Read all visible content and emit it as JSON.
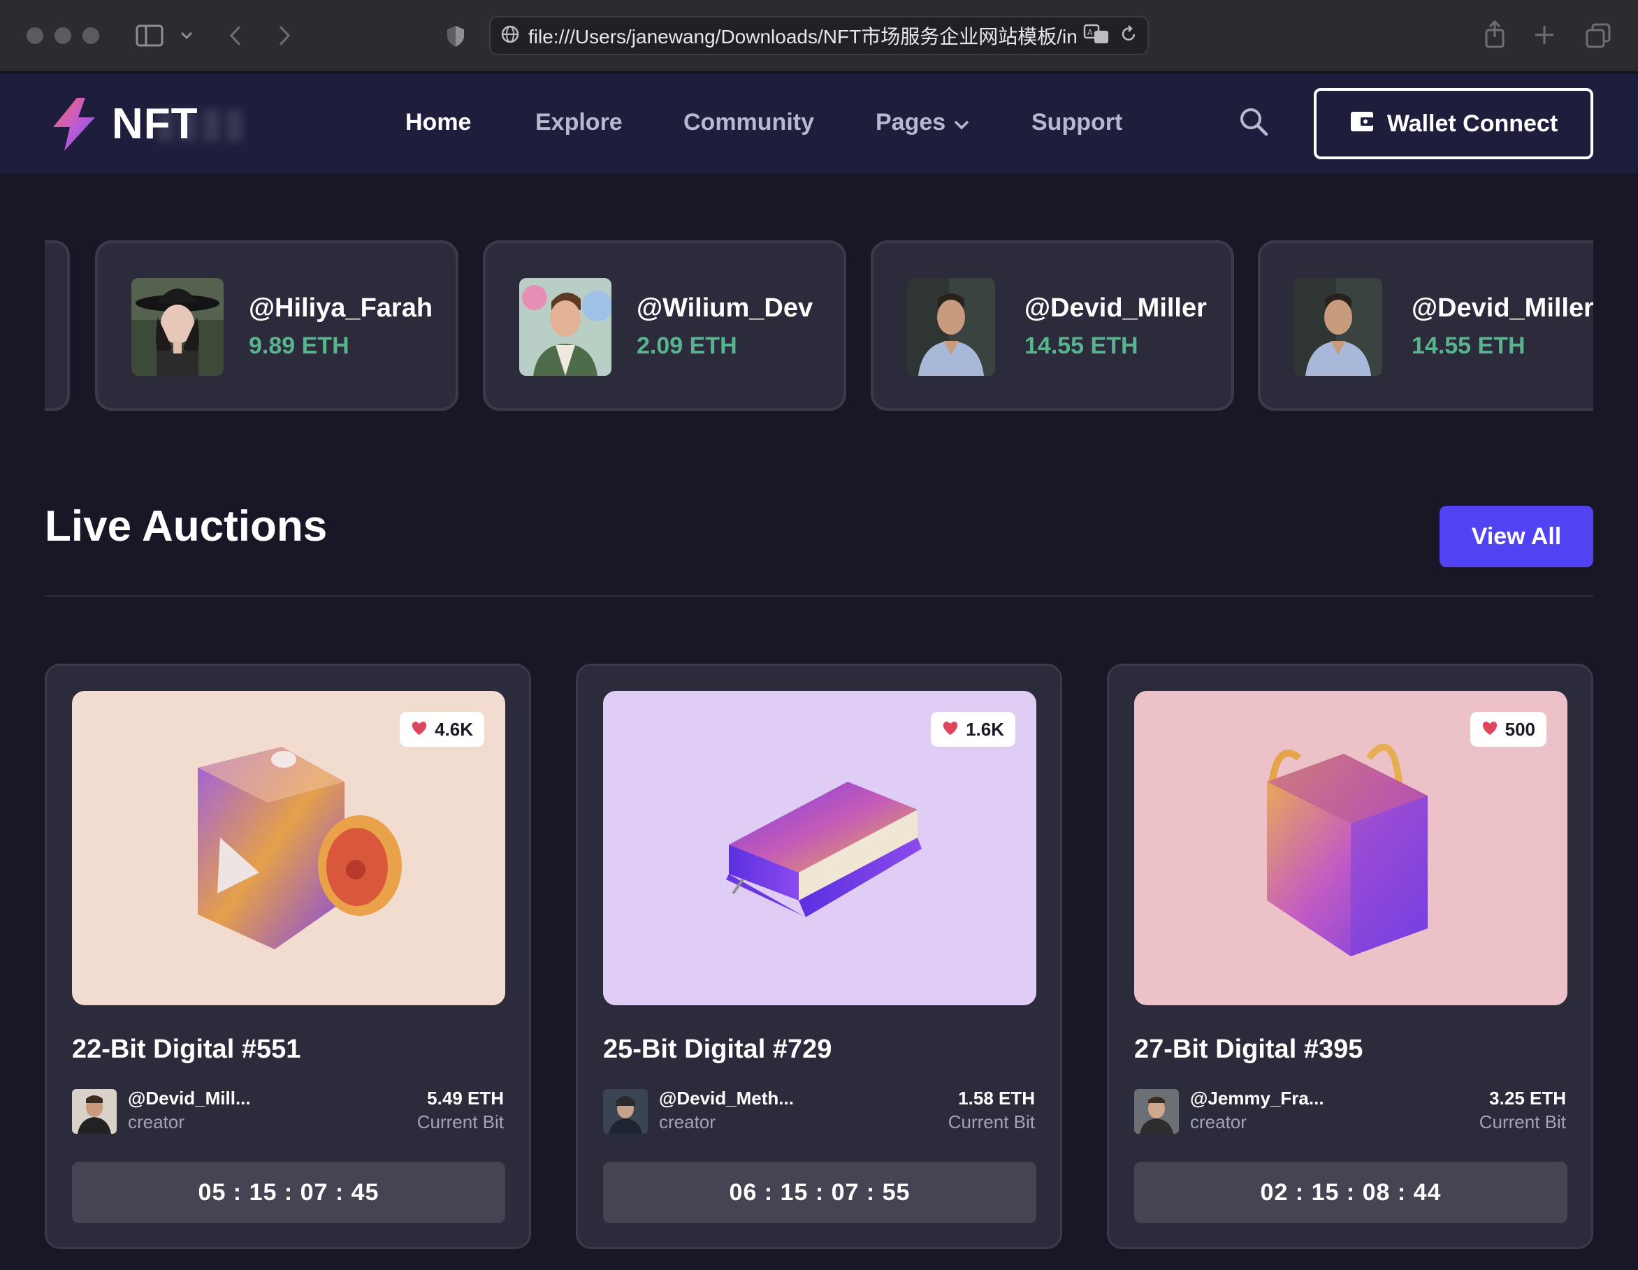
{
  "browser": {
    "url": "file:///Users/janewang/Downloads/NFT市场服务企业网站模板/inde:"
  },
  "header": {
    "logo_text": "NFT",
    "nav": [
      {
        "label": "Home",
        "active": true
      },
      {
        "label": "Explore"
      },
      {
        "label": "Community"
      },
      {
        "label": "Pages"
      },
      {
        "label": "Support"
      }
    ],
    "wallet_label": "Wallet Connect"
  },
  "sellers": [
    {
      "name": "@Hiliya_Farah",
      "eth": "9.89 ETH"
    },
    {
      "name": "@Wilium_Dev",
      "eth": "2.09 ETH"
    },
    {
      "name": "@Devid_Miller",
      "eth": "14.55 ETH"
    },
    {
      "name": "@Devid_Miller",
      "eth": "14.55 ETH"
    }
  ],
  "auctions": {
    "title": "Live Auctions",
    "view_all": "View All",
    "cards": [
      {
        "likes": "4.6K",
        "title": "22-Bit Digital #551",
        "creator": "@Devid_Mill...",
        "role": "creator",
        "price": "5.49 ETH",
        "price_label": "Current Bit",
        "timer": "05 : 15 : 07 : 45"
      },
      {
        "likes": "1.6K",
        "title": "25-Bit Digital #729",
        "creator": "@Devid_Meth...",
        "role": "creator",
        "price": "1.58 ETH",
        "price_label": "Current Bit",
        "timer": "06 : 15 : 07 : 55"
      },
      {
        "likes": "500",
        "title": "27-Bit Digital #395",
        "creator": "@Jemmy_Fra...",
        "role": "creator",
        "price": "3.25 ETH",
        "price_label": "Current Bit",
        "timer": "02 : 15 : 08 : 44"
      }
    ]
  },
  "colors": {
    "background": "#191726",
    "header": "#1e1e3c",
    "card": "#2c2b3b",
    "accent": "#5142f2",
    "eth_green": "#58b48e",
    "heart": "#e0455f"
  }
}
